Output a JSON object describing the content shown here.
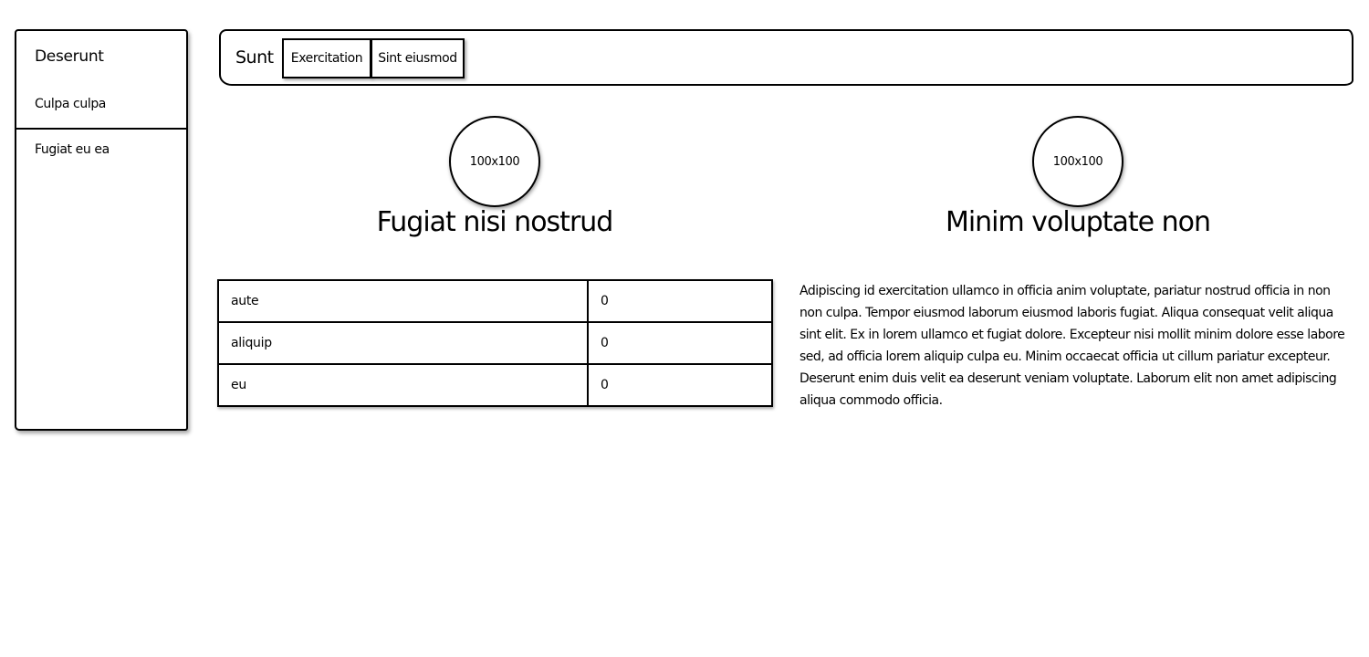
{
  "sidebar": {
    "title": "Deserunt",
    "items": [
      {
        "label": "Culpa culpa"
      },
      {
        "label": "Fugiat eu ea"
      }
    ]
  },
  "topnav": {
    "brand": "Sunt",
    "buttons": [
      {
        "label": "Exercitation"
      },
      {
        "label": "Sint eiusmod"
      }
    ]
  },
  "cards": [
    {
      "avatar_label": "100x100",
      "heading": "Fugiat nisi nostrud"
    },
    {
      "avatar_label": "100x100",
      "heading": "Minim voluptate non"
    }
  ],
  "table": {
    "rows": [
      {
        "name": "aute",
        "value": "0"
      },
      {
        "name": "aliquip",
        "value": "0"
      },
      {
        "name": "eu",
        "value": "0"
      }
    ]
  },
  "paragraph": "Adipiscing id exercitation ullamco in officia anim voluptate, pariatur nostrud officia in non non culpa. Tempor eiusmod laborum eiusmod laboris fugiat. Aliqua consequat velit aliqua sint elit. Ex in lorem ullamco et fugiat dolore. Excepteur nisi mollit minim dolore esse labore sed, ad officia lorem aliquip culpa eu. Minim occaecat officia ut cillum pariatur excepteur. Deserunt enim duis velit ea deserunt veniam voluptate. Laborum elit non amet adipiscing aliqua commodo officia."
}
